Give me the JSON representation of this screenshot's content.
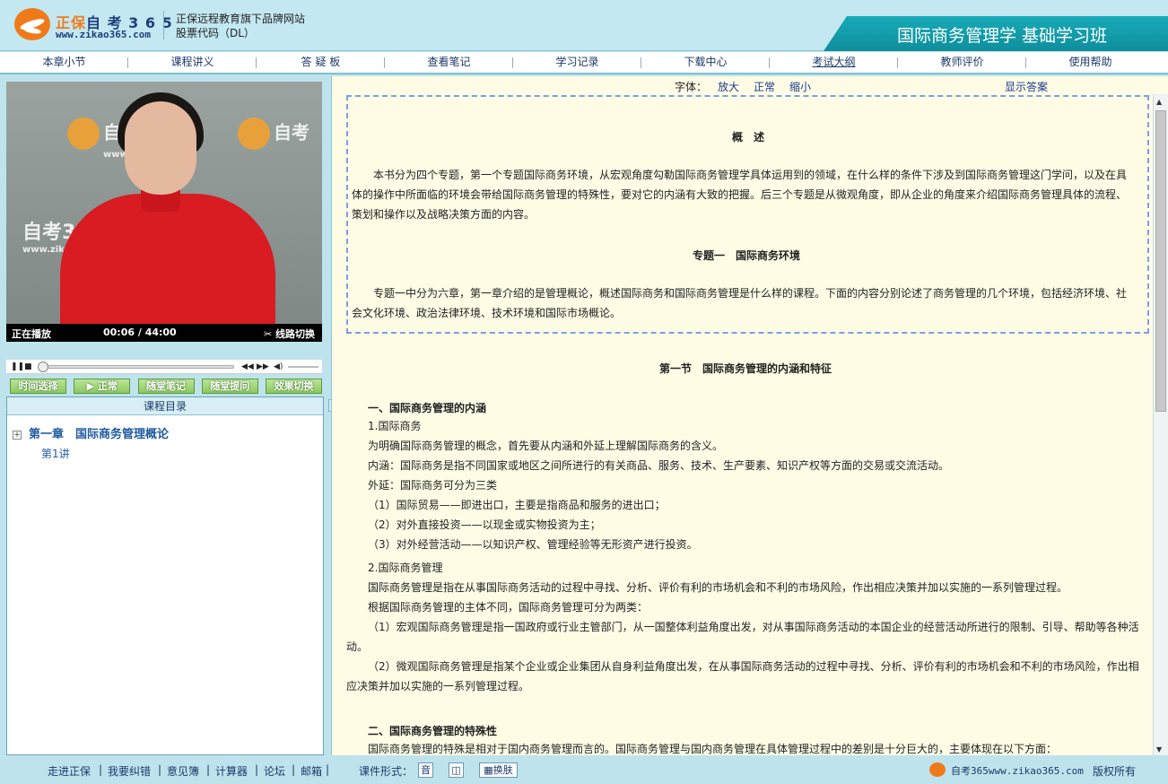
{
  "header": {
    "brand_cn": "正保",
    "brand_name": "自 考 3 6 5",
    "brand_url": "www.zikao365.com",
    "tagline": "正保远程教育旗下品牌网站",
    "stock": "股票代码（DL）",
    "course_title": "国际商务管理学 基础学习班"
  },
  "nav": [
    "本章小节",
    "课程讲义",
    "答 疑 板",
    "查看笔记",
    "学习记录",
    "下载中心",
    "考试大纲",
    "教师评价",
    "使用帮助"
  ],
  "player": {
    "watermark_brand": "自考",
    "watermark_url": "www.zikao.com",
    "watermark_brand_large": "自考365",
    "watermark_url_large": "www.zikao365.com",
    "status": "正在播放",
    "time": "00:06 / 44:00",
    "line_switch": "线路切换",
    "progress_fraction": 0.0023
  },
  "func_buttons": [
    "时间选择",
    "正常",
    "随堂笔记",
    "随堂提问",
    "效果切换"
  ],
  "catalog": {
    "heading": "课程目录",
    "chapter": "第一章　国际商务管理概论",
    "lecture": "第1讲"
  },
  "toolbar": {
    "font_label": "字体：",
    "zoom_in": "放大",
    "zoom_normal": "正常",
    "zoom_out": "缩小",
    "show_answer": "显示答案"
  },
  "content": {
    "overview_title": "概　述",
    "overview_para": "本书分为四个专题，第一个专题国际商务环境，从宏观角度勾勒国际商务管理学具体运用到的领域，在什么样的条件下涉及到国际商务管理这门学问，以及在具体的操作中所面临的环境会带给国际商务管理的特殊性，要对它的内涵有大致的把握。后三个专题是从微观角度，即从企业的角度来介绍国际商务管理具体的流程、策划和操作以及战略决策方面的内容。",
    "topic1_title": "专题一　国际商务环境",
    "topic1_para": "专题一中分为六章，第一章介绍的是管理概论，概述国际商务和国际商务管理是什么样的课程。下面的内容分别论述了商务管理的几个环境，包括经济环境、社会文化环境、政治法律环境、技术环境和国际市场概论。",
    "section1_title": "第一节　国际商务管理的内涵和特征",
    "h1": "一、国际商务管理的内涵",
    "l1": "1.国际商务",
    "l2": "为明确国际商务管理的概念，首先要从内涵和外延上理解国际商务的含义。",
    "l3": "内涵：国际商务是指不同国家或地区之间所进行的有关商品、服务、技术、生产要素、知识产权等方面的交易或交流活动。",
    "l4": "外延：国际商务可分为三类",
    "l5": "（1）国际贸易——即进出口，主要是指商品和服务的进出口；",
    "l6": "（2）对外直接投资——以现金或实物投资为主；",
    "l7": "（3）对外经营活动——以知识产权、管理经验等无形资产进行投资。",
    "l8": "2.国际商务管理",
    "l9": "国际商务管理是指在从事国际商务活动的过程中寻找、分析、评价有利的市场机会和不利的市场风险，作出相应决策并加以实施的一系列管理过程。",
    "l10": "根据国际商务管理的主体不同，国际商务管理可分为两类：",
    "p_macro": "（1）宏观国际商务管理是指一国政府或行业主管部门，从一国整体利益角度出发，对从事国际商务活动的本国企业的经营活动所进行的限制、引导、帮助等各种活动。",
    "p_micro": "（2）微观国际商务管理是指某个企业或企业集团从自身利益角度出发，在从事国际商务活动的过程中寻找、分析、评价有利的市场机会和不利的市场风险，作出相应决策并加以实施的一系列管理过程。",
    "h2": "二、国际商务管理的特殊性",
    "l11": "国际商务管理的特殊是相对于国内商务管理而言的。国际商务管理与国内商务管理在具体管理过程中的差别是十分巨大的，主要体现在以下方面："
  },
  "footer": {
    "links": [
      "走进正保",
      "我要纠错",
      "意见簿",
      "计算器",
      "论坛",
      "邮箱"
    ],
    "format_label": "课件形式：",
    "fmt_audio": "音",
    "skin": "换肤",
    "site": "自考365www.zikao365.com",
    "copyright": "版权所有"
  }
}
